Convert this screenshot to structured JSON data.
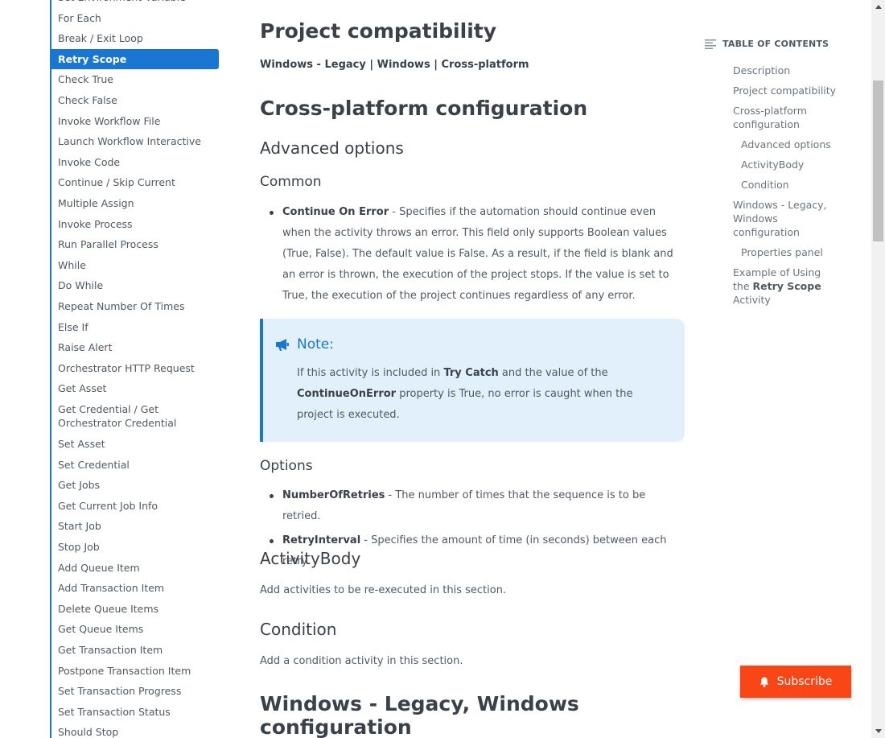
{
  "sidebar": {
    "items": [
      {
        "label": "Set Environment Variable",
        "active": false
      },
      {
        "label": "For Each",
        "active": false
      },
      {
        "label": "Break / Exit Loop",
        "active": false
      },
      {
        "label": "Retry Scope",
        "active": true
      },
      {
        "label": "Check True",
        "active": false
      },
      {
        "label": "Check False",
        "active": false
      },
      {
        "label": "Invoke Workflow File",
        "active": false
      },
      {
        "label": "Launch Workflow Interactive",
        "active": false
      },
      {
        "label": "Invoke Code",
        "active": false
      },
      {
        "label": "Continue / Skip Current",
        "active": false
      },
      {
        "label": "Multiple Assign",
        "active": false
      },
      {
        "label": "Invoke Process",
        "active": false
      },
      {
        "label": "Run Parallel Process",
        "active": false
      },
      {
        "label": "While",
        "active": false
      },
      {
        "label": "Do While",
        "active": false
      },
      {
        "label": "Repeat Number Of Times",
        "active": false
      },
      {
        "label": "Else If",
        "active": false
      },
      {
        "label": "Raise Alert",
        "active": false
      },
      {
        "label": "Orchestrator HTTP Request",
        "active": false
      },
      {
        "label": "Get Asset",
        "active": false
      },
      {
        "label": "Get Credential / Get Orchestrator Credential",
        "active": false
      },
      {
        "label": "Set Asset",
        "active": false
      },
      {
        "label": "Set Credential",
        "active": false
      },
      {
        "label": "Get Jobs",
        "active": false
      },
      {
        "label": "Get Current Job Info",
        "active": false
      },
      {
        "label": "Start Job",
        "active": false
      },
      {
        "label": "Stop Job",
        "active": false
      },
      {
        "label": "Add Queue Item",
        "active": false
      },
      {
        "label": "Add Transaction Item",
        "active": false
      },
      {
        "label": "Delete Queue Items",
        "active": false
      },
      {
        "label": "Get Queue Items",
        "active": false
      },
      {
        "label": "Get Transaction Item",
        "active": false
      },
      {
        "label": "Postpone Transaction Item",
        "active": false
      },
      {
        "label": "Set Transaction Progress",
        "active": false
      },
      {
        "label": "Set Transaction Status",
        "active": false
      },
      {
        "label": "Should Stop",
        "active": false
      }
    ]
  },
  "content": {
    "compat_heading": "Project compatibility",
    "compat_text": "Windows - Legacy | Windows | Cross-platform",
    "cross_heading": "Cross-platform configuration",
    "advanced_heading": "Advanced options",
    "common_heading": "Common",
    "continue_on_error": {
      "term": "Continue On Error",
      "text": " - Specifies if the automation should continue even when the activity throws an error. This field only supports Boolean values (True, False). The default value is False. As a result, if the field is blank and an error is thrown, the execution of the project stops. If the value is set to True, the execution of the project continues regardless of any error."
    },
    "note": {
      "title": "Note:",
      "text_1": "If this activity is included in ",
      "bold_1": "Try Catch",
      "text_2": " and the value of the ",
      "bold_2": "ContinueOnError",
      "text_3": " property is True, no error is caught when the project is executed."
    },
    "options_heading": "Options",
    "options": [
      {
        "term": "NumberOfRetries",
        "text": " - The number of times that the sequence is to be retried."
      },
      {
        "term": "RetryInterval",
        "text": " - Specifies the amount of time (in seconds) between each retry."
      }
    ],
    "activitybody_heading": "ActivityBody",
    "activitybody_text": "Add activities to be re-executed in this section.",
    "condition_heading": "Condition",
    "condition_text": "Add a condition activity in this section.",
    "windows_heading": "Windows - Legacy, Windows configuration"
  },
  "toc": {
    "title": "TABLE OF CONTENTS",
    "links": {
      "description": "Description",
      "project_compat": "Project compatibility",
      "cross_platform": "Cross-platform configuration",
      "advanced": "Advanced options",
      "activitybody": "ActivityBody",
      "condition": "Condition",
      "windows": "Windows - Legacy, Windows configuration",
      "properties": "Properties panel",
      "example_pre": "Example of Using the ",
      "example_bold": "Retry Scope",
      "example_post": " Activity"
    }
  },
  "subscribe_label": "Subscribe",
  "icons": {
    "note": "megaphone-icon",
    "toc": "list-icon",
    "subscribe": "bell-icon",
    "scroll_up": "scroll-up-arrow-icon",
    "scroll_down": "scroll-down-arrow-icon"
  },
  "colors": {
    "accent": "#1976d2",
    "subscribe": "#fa4616",
    "note_bg": "#e2f0fc"
  }
}
